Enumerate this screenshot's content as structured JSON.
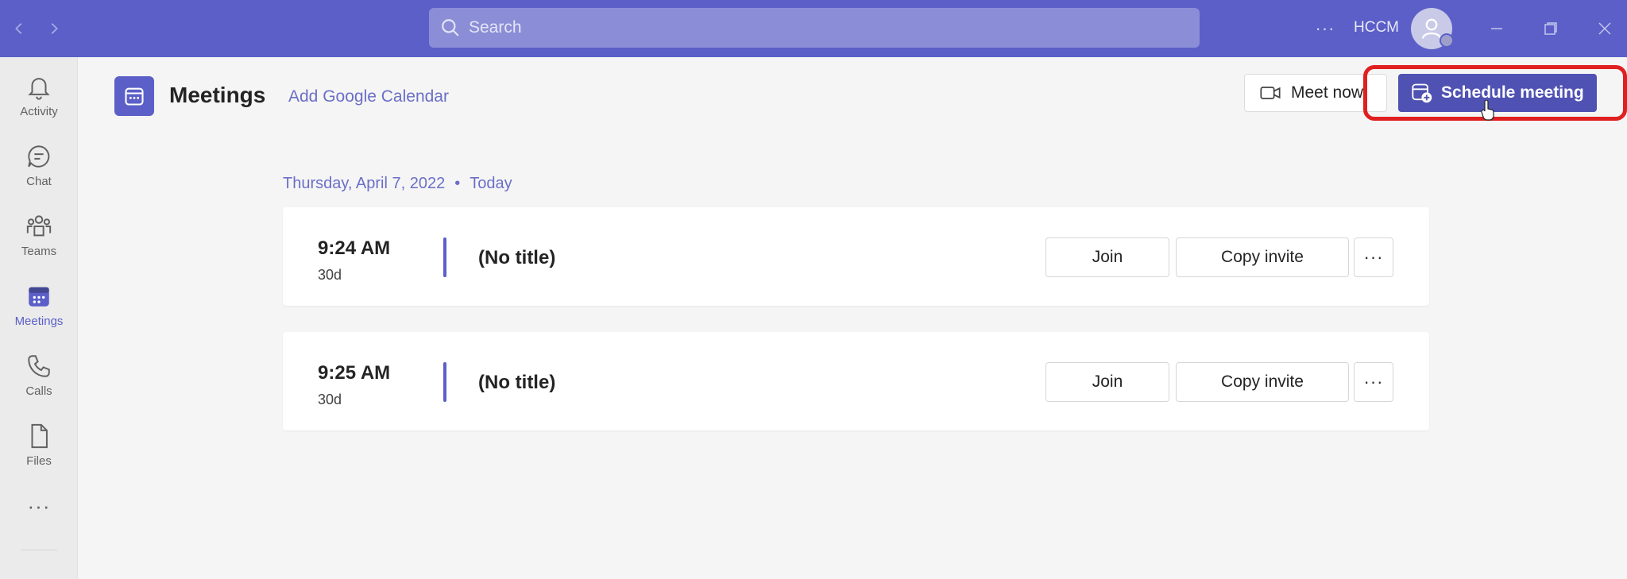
{
  "titlebar": {
    "search_placeholder": "Search",
    "more": "···",
    "org": "HCCM"
  },
  "rail": {
    "items": [
      {
        "label": "Activity",
        "icon": "bell-icon"
      },
      {
        "label": "Chat",
        "icon": "chat-icon"
      },
      {
        "label": "Teams",
        "icon": "teams-icon"
      },
      {
        "label": "Meetings",
        "icon": "calendar-icon",
        "active": true
      },
      {
        "label": "Calls",
        "icon": "phone-icon"
      },
      {
        "label": "Files",
        "icon": "file-icon"
      }
    ],
    "more": "···"
  },
  "header": {
    "title": "Meetings",
    "add_calendar": "Add Google Calendar",
    "meet_now": "Meet now",
    "schedule_meeting": "Schedule meeting"
  },
  "date_header": {
    "date": "Thursday, April 7, 2022",
    "separator": "•",
    "today": "Today"
  },
  "meetings": [
    {
      "time": "9:24 AM",
      "duration": "30d",
      "title": "(No title)",
      "join": "Join",
      "copy_invite": "Copy invite",
      "more": "···"
    },
    {
      "time": "9:25 AM",
      "duration": "30d",
      "title": "(No title)",
      "join": "Join",
      "copy_invite": "Copy invite",
      "more": "···"
    }
  ],
  "colors": {
    "brand": "#5b5fc7",
    "primary_button": "#4f52b2",
    "highlight": "#e02020"
  }
}
